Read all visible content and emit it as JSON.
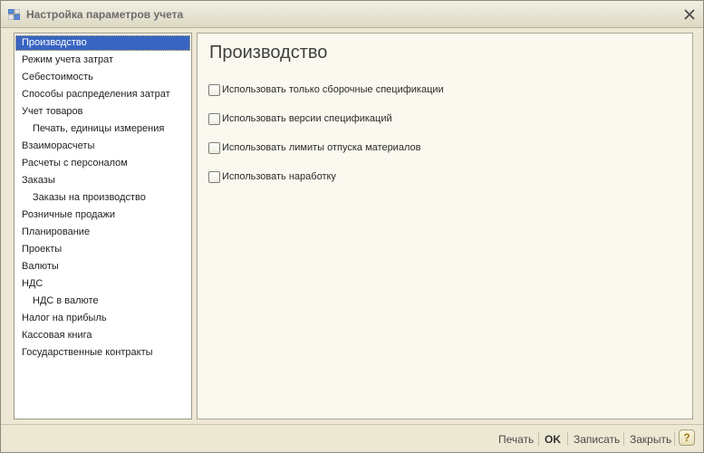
{
  "window": {
    "title": "Настройка параметров учета"
  },
  "sidebar": {
    "items": [
      {
        "label": "Производство",
        "selected": true,
        "level": 0
      },
      {
        "label": "Режим учета затрат",
        "level": 0
      },
      {
        "label": "Себестоимость",
        "level": 0
      },
      {
        "label": "Способы распределения затрат",
        "level": 0
      },
      {
        "label": "Учет товаров",
        "level": 0
      },
      {
        "label": "Печать, единицы измерения",
        "level": 1
      },
      {
        "label": "Взаиморасчеты",
        "level": 0
      },
      {
        "label": "Расчеты с персоналом",
        "level": 0
      },
      {
        "label": "Заказы",
        "level": 0
      },
      {
        "label": "Заказы на производство",
        "level": 1
      },
      {
        "label": "Розничные продажи",
        "level": 0
      },
      {
        "label": "Планирование",
        "level": 0
      },
      {
        "label": "Проекты",
        "level": 0
      },
      {
        "label": "Валюты",
        "level": 0
      },
      {
        "label": "НДС",
        "level": 0
      },
      {
        "label": "НДС в валюте",
        "level": 1
      },
      {
        "label": "Налог на прибыль",
        "level": 0
      },
      {
        "label": "Кассовая книга",
        "level": 0
      },
      {
        "label": "Государственные контракты",
        "level": 0
      }
    ]
  },
  "main": {
    "title": "Производство",
    "options": [
      {
        "label": "Использовать только сборочные спецификации",
        "checked": false
      },
      {
        "label": "Использовать версии спецификаций",
        "checked": false
      },
      {
        "label": "Использовать лимиты отпуска материалов",
        "checked": false
      },
      {
        "label": "Использовать наработку",
        "checked": false
      }
    ]
  },
  "footer": {
    "print_label": "Печать",
    "ok_label": "OK",
    "save_label": "Записать",
    "close_label": "Закрыть",
    "help_label": "?"
  },
  "colors": {
    "selection": "#3965c2",
    "panel_bg": "#fbf9ef",
    "window_bg": "#ece8d3"
  }
}
